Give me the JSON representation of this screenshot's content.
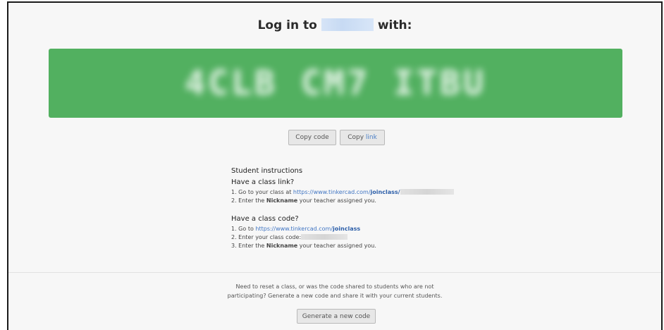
{
  "header": {
    "title_prefix": "Log in to",
    "title_suffix": "with:"
  },
  "code_box": {
    "code_text": "4CLB CM7 ITBU",
    "color": "#52b060"
  },
  "buttons": {
    "copy_code": "Copy code",
    "copy_link_prefix": "Copy ",
    "copy_link_link": "link",
    "generate": "Generate a new code"
  },
  "instructions": {
    "heading": "Student instructions",
    "section1": {
      "title": "Have a class link?",
      "line1_prefix": "1. Go to your class at ",
      "line1_link": "https://www.tinkercad.com/",
      "line1_link_bold": "joinclass/",
      "line2_prefix": "2. Enter the ",
      "line2_bold": "Nickname",
      "line2_suffix": " your teacher assigned you."
    },
    "section2": {
      "title": "Have a class code?",
      "line1_prefix": "1. Go to ",
      "line1_link": "https://www.tinkercad.com/",
      "line1_link_bold": "joinclass",
      "line2_prefix": "2. Enter your class code:",
      "line3_prefix": "3. Enter the ",
      "line3_bold": "Nickname",
      "line3_suffix": " your teacher assigned you."
    }
  },
  "footer": {
    "line1": "Need to reset a class, or was the code shared to students who are not",
    "line2": "participating? Generate a new code and share it with your current students."
  }
}
